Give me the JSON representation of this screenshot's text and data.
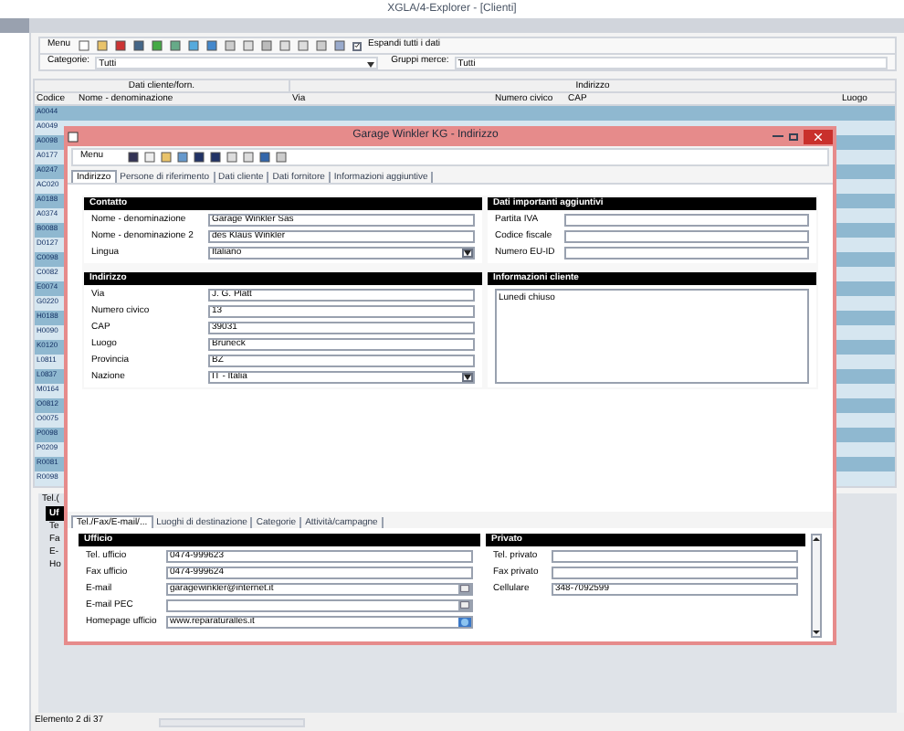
{
  "window": {
    "title": "XGLA/4-Explorer - [Clienti]"
  },
  "toolbar": {
    "menu": "Menu",
    "expand_all": {
      "label": "Espandi tutti i dati",
      "checked": true
    }
  },
  "filters": [
    {
      "label": "Categorie:",
      "value": "Tutti"
    },
    {
      "label": "Gruppi merce:",
      "value": "Tutti"
    }
  ],
  "table": {
    "groups": [
      "Dati cliente/forn.",
      "Indirizzo"
    ],
    "columns": [
      "Codice",
      "Nome - denominazione",
      "Via",
      "Numero civico",
      "CAP",
      "Luogo"
    ],
    "codes": [
      "A0044",
      "A0049",
      "A0098",
      "A0177",
      "A0247",
      "AC020",
      "A0188",
      "A0374",
      "B0088",
      "D0127",
      "C0098",
      "C0082",
      "E0074",
      "G0220",
      "H0188",
      "H0090",
      "K0120",
      "L0811",
      "L0837",
      "M0164",
      "O0812",
      "O0075",
      "P0098",
      "P0209",
      "R0081",
      "R0098"
    ]
  },
  "detail": {
    "tab": "Tel.(",
    "header": "Uf",
    "labels": [
      "Te",
      "Fa",
      "E-",
      "Ho"
    ]
  },
  "status_bar": "Elemento 2 di 37",
  "dialog": {
    "title": "Garage Winkler KG - Indirizzo",
    "menu": "Menu",
    "tabs": [
      {
        "label": "Indirizzo",
        "selected": true
      },
      {
        "label": "Persone di riferimento",
        "selected": false
      },
      {
        "label": "Dati cliente",
        "selected": false
      },
      {
        "label": "Dati fornitore",
        "selected": false
      },
      {
        "label": "Informazioni aggiuntive",
        "selected": false
      }
    ],
    "contatto": {
      "title": "Contatto",
      "fields": [
        {
          "label": "Nome - denominazione",
          "value": "Garage Winkler Sas",
          "kind": "text"
        },
        {
          "label": "Nome - denominazione 2",
          "value": "des Klaus Winkler",
          "kind": "text"
        },
        {
          "label": "Lingua",
          "value": "Italiano",
          "kind": "dropdown"
        }
      ]
    },
    "dati_aggiuntivi": {
      "title": "Dati importanti aggiuntivi",
      "fields": [
        {
          "label": "Partita IVA",
          "kind": "text"
        },
        {
          "label": "Codice fiscale",
          "kind": "text"
        },
        {
          "label": "Numero EU-ID",
          "kind": "text"
        }
      ]
    },
    "indirizzo": {
      "title": "Indirizzo",
      "fields": [
        {
          "label": "Via",
          "value": "J. G. Platt",
          "kind": "text"
        },
        {
          "label": "Numero civico",
          "value": "13",
          "kind": "text"
        },
        {
          "label": "CAP",
          "value": "39031",
          "kind": "text"
        },
        {
          "label": "Luogo",
          "value": "Bruneck",
          "kind": "text"
        },
        {
          "label": "Provincia",
          "value": "BZ",
          "kind": "text"
        },
        {
          "label": "Nazione",
          "value": "IT - Italia",
          "kind": "dropdown"
        }
      ]
    },
    "informazioni": {
      "title": "Informazioni cliente",
      "text": "Lunedi chiuso"
    },
    "bottom_tabs": [
      {
        "label": "Tel./Fax/E-mail/...",
        "selected": true
      },
      {
        "label": "Luoghi di destinazione",
        "selected": false
      },
      {
        "label": "Categorie",
        "selected": false
      },
      {
        "label": "Attività/campagne",
        "selected": false
      }
    ],
    "ufficio": {
      "title": "Ufficio",
      "fields": [
        {
          "label": "Tel. ufficio",
          "value": "0474-999623",
          "kind": "text"
        },
        {
          "label": "Fax ufficio",
          "value": "0474-999624",
          "kind": "text"
        },
        {
          "label": "E-mail",
          "value": "garagewinkler@internet.it",
          "kind": "mail"
        },
        {
          "label": "E-mail PEC",
          "kind": "mail"
        },
        {
          "label": "Homepage ufficio",
          "value": "www.reparaturalles.it",
          "kind": "web"
        }
      ]
    },
    "privato": {
      "title": "Privato",
      "fields": [
        {
          "label": "Tel. privato",
          "kind": "text"
        },
        {
          "label": "Fax privato",
          "kind": "text"
        },
        {
          "label": "Cellulare",
          "value": "348-7092599",
          "kind": "text"
        }
      ]
    }
  }
}
